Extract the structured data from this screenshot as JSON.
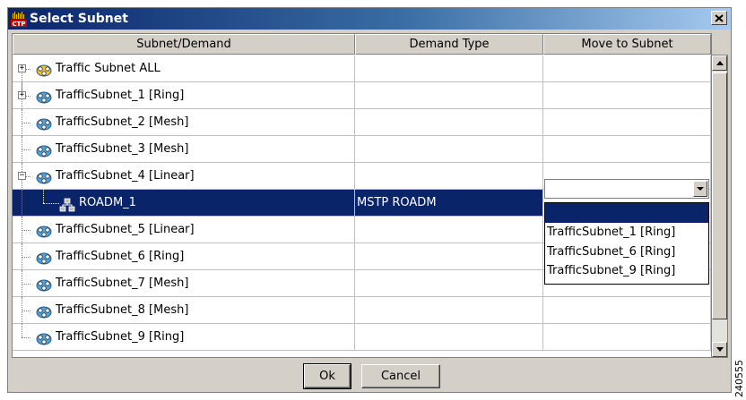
{
  "window": {
    "title": "Select Subnet",
    "app_icon": "ctp-icon",
    "close_icon": "close-icon"
  },
  "table": {
    "columns": [
      "Subnet/Demand",
      "Demand Type",
      "Move to Subnet"
    ],
    "rows": [
      {
        "label": "Traffic Subnet ALL",
        "type": "",
        "expander": "+",
        "level": 0,
        "icon": "subnet-icon-gold"
      },
      {
        "label": "TrafficSubnet_1 [Ring]",
        "type": "",
        "expander": "+",
        "level": 0,
        "icon": "subnet-icon-blue"
      },
      {
        "label": "TrafficSubnet_2 [Mesh]",
        "type": "",
        "expander": "",
        "level": 0,
        "icon": "subnet-icon-blue"
      },
      {
        "label": "TrafficSubnet_3 [Mesh]",
        "type": "",
        "expander": "",
        "level": 0,
        "icon": "subnet-icon-blue"
      },
      {
        "label": "TrafficSubnet_4 [Linear]",
        "type": "",
        "expander": "−",
        "level": 0,
        "icon": "subnet-icon-blue"
      },
      {
        "label": "ROADM_1",
        "type": "MSTP ROADM",
        "expander": "",
        "level": 1,
        "icon": "network-node-icon",
        "selected": true
      },
      {
        "label": "TrafficSubnet_5 [Linear]",
        "type": "",
        "expander": "",
        "level": 0,
        "icon": "subnet-icon-blue"
      },
      {
        "label": "TrafficSubnet_6 [Ring]",
        "type": "",
        "expander": "",
        "level": 0,
        "icon": "subnet-icon-blue"
      },
      {
        "label": "TrafficSubnet_7 [Mesh]",
        "type": "",
        "expander": "",
        "level": 0,
        "icon": "subnet-icon-blue"
      },
      {
        "label": "TrafficSubnet_8 [Mesh]",
        "type": "",
        "expander": "",
        "level": 0,
        "icon": "subnet-icon-blue"
      },
      {
        "label": "TrafficSubnet_9 [Ring]",
        "type": "",
        "expander": "",
        "level": 0,
        "icon": "subnet-icon-blue"
      }
    ]
  },
  "move_to": {
    "current_value": "",
    "options": [
      "",
      "TrafficSubnet_1 [Ring]",
      "TrafficSubnet_6 [Ring]",
      "TrafficSubnet_9 [Ring]"
    ]
  },
  "buttons": {
    "ok": "Ok",
    "cancel": "Cancel"
  },
  "watermark": "240555",
  "colors": {
    "titlebar_start": "#0a246a",
    "selection": "#0a246a",
    "face": "#d4d0c8"
  }
}
